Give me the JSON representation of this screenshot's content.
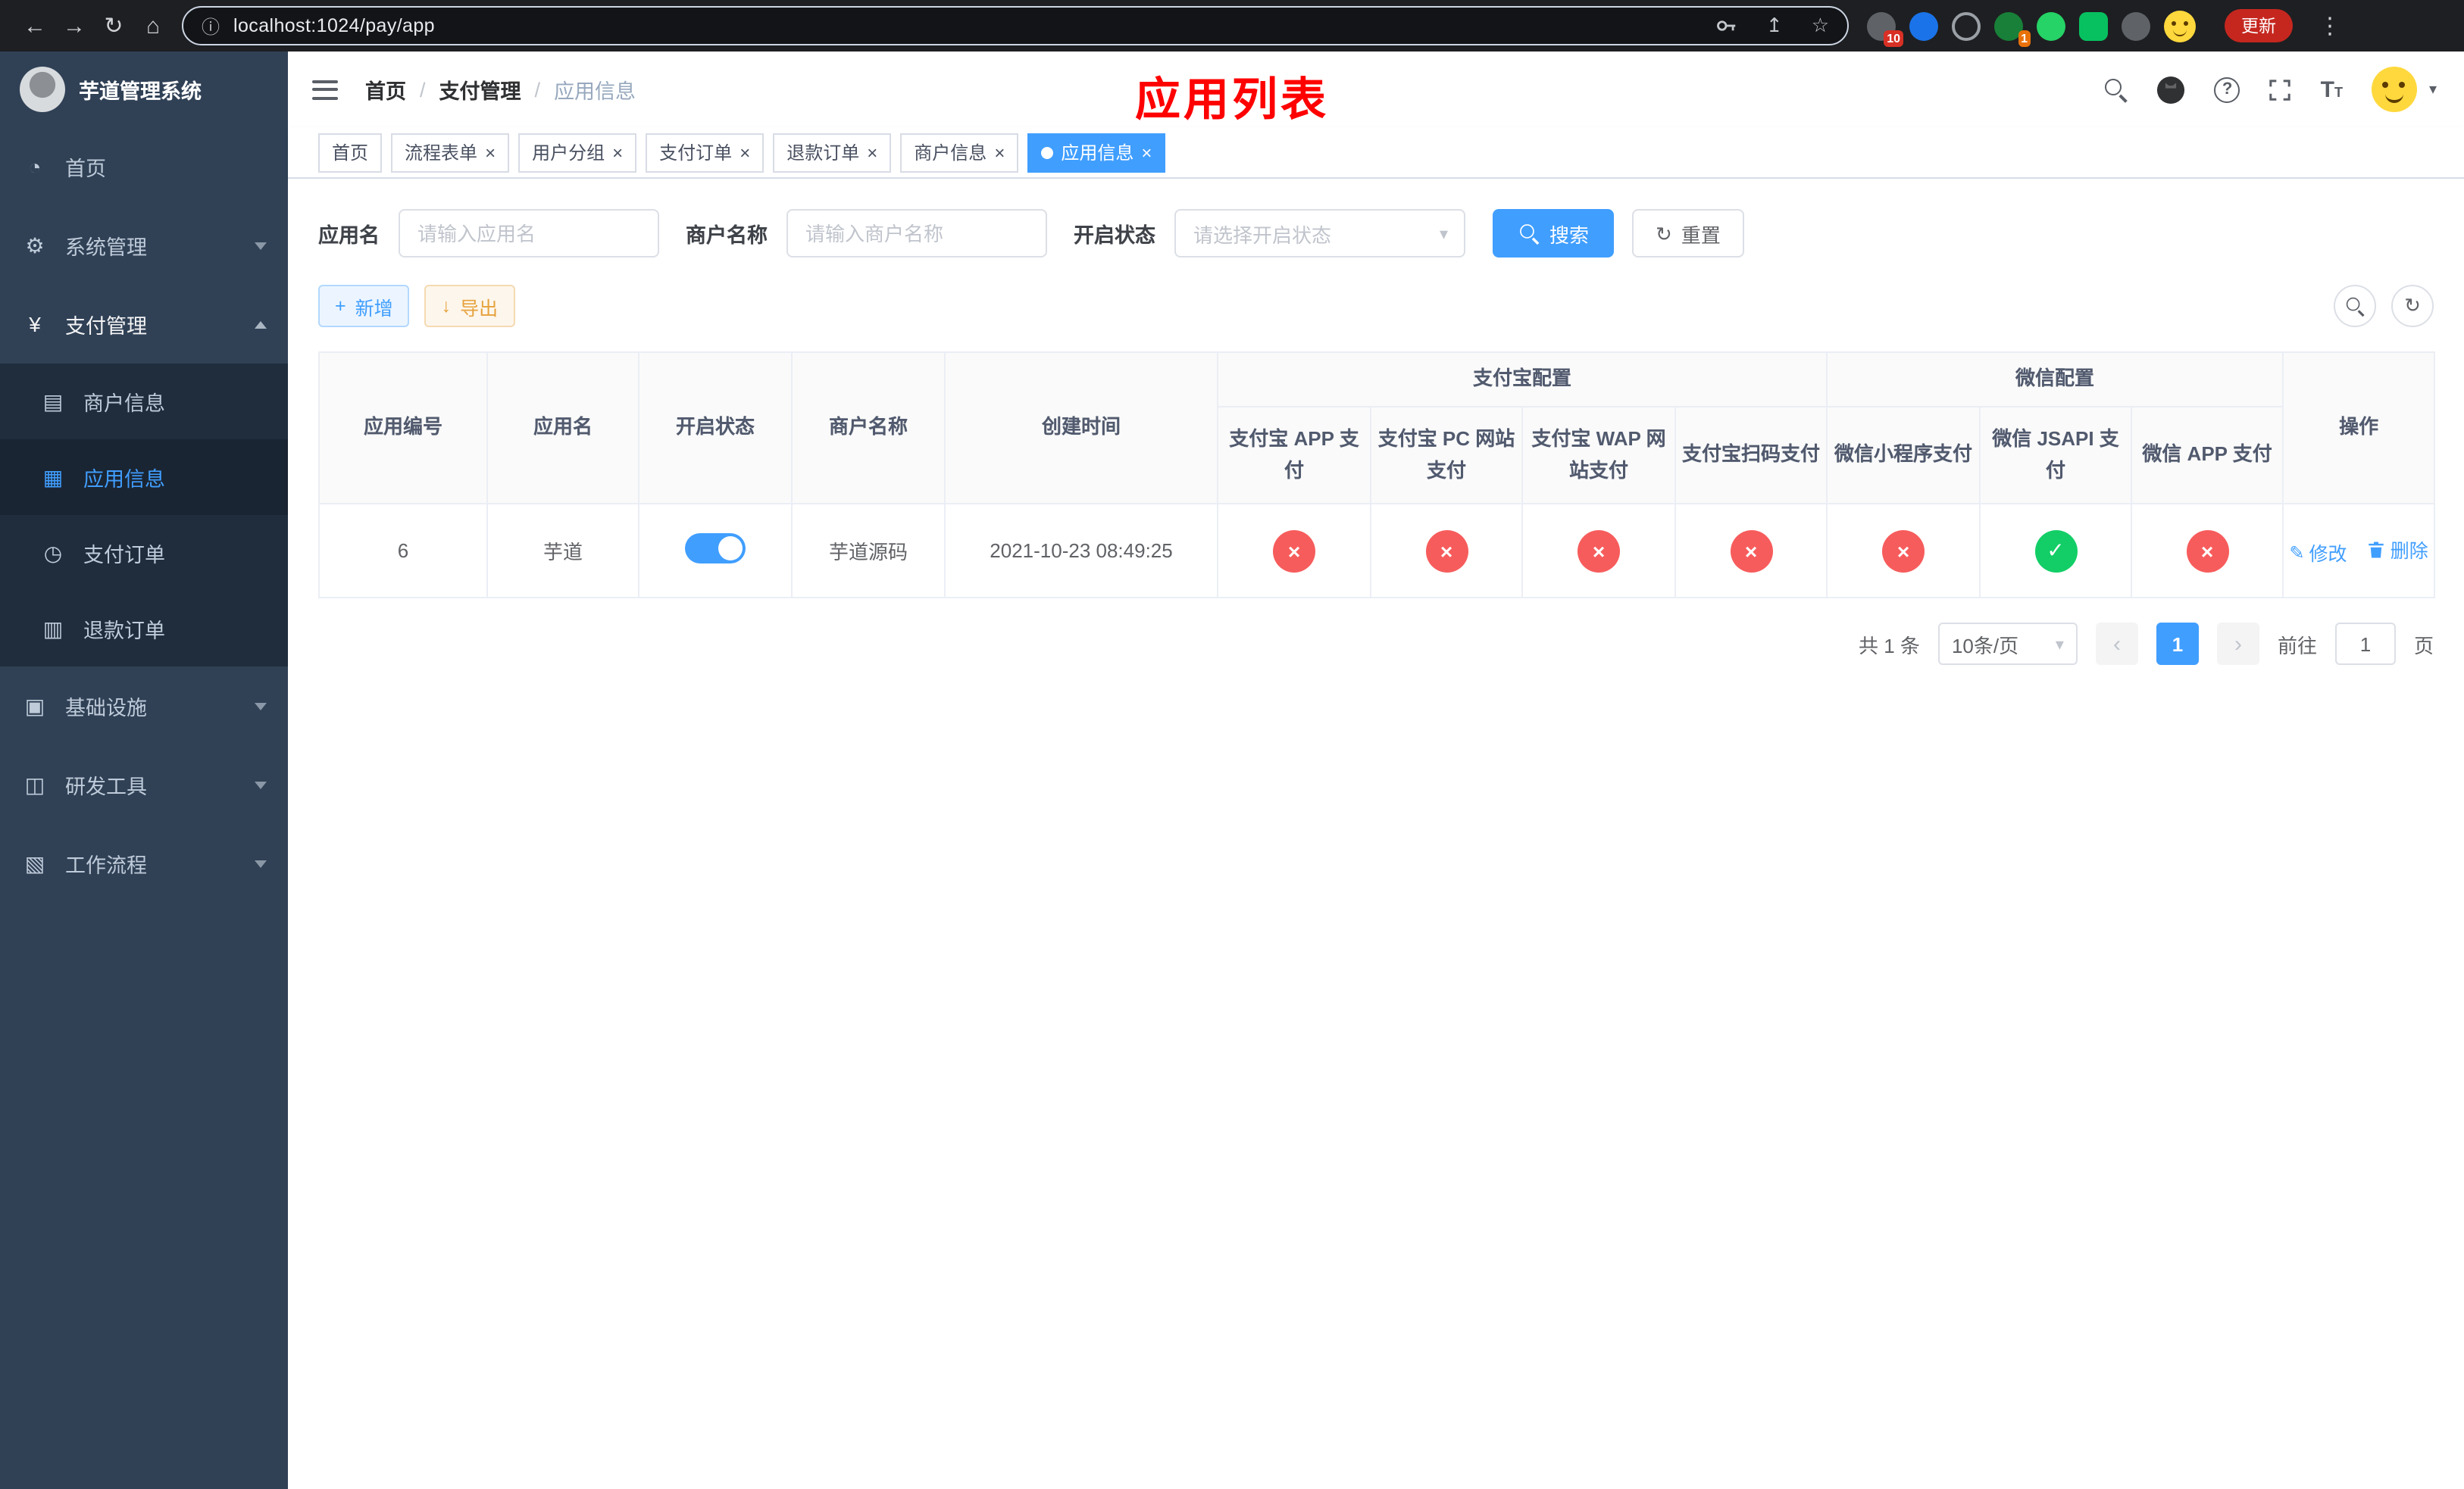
{
  "colors": {
    "primary": "#409EFF",
    "success": "#13ce66",
    "danger": "#f75c5c",
    "warning": "#e6a23c",
    "sidebar_bg": "#304156",
    "submenu_bg": "#1f2d3d",
    "tag_active": "#409EFF",
    "annotation_red": "#ff0000",
    "update_chip": "#c5271f"
  },
  "icons": {
    "back": "←",
    "forward": "→",
    "reload": "↻",
    "home": "⌂",
    "info": "ⓘ",
    "share": "↥",
    "star": "☆",
    "kebab": "⋮",
    "dashboard": "◔",
    "gear": "⚙",
    "yen": "¥",
    "card": "▤",
    "grid": "▦",
    "order": "◷",
    "refund": "▥",
    "infra": "▣",
    "tools": "◫",
    "workflow": "▧",
    "slash": "/",
    "help": "?",
    "font_large": "T",
    "font_small": "T",
    "caret_small": "▾",
    "caret": "▾",
    "close": "×",
    "check": "✓",
    "cross": "×",
    "plus": "+",
    "download": "↓",
    "refresh": "↻",
    "edit": "✎",
    "prev": "‹",
    "next": "›"
  },
  "browser": {
    "url": "localhost:1024/pay/app",
    "update_label": "更新",
    "ext_badges": {
      "first": "10",
      "second": "1"
    }
  },
  "sidebar": {
    "title": "芋道管理系统",
    "items": [
      {
        "label": "首页"
      },
      {
        "label": "系统管理"
      },
      {
        "label": "支付管理"
      },
      {
        "label": "基础设施"
      },
      {
        "label": "研发工具"
      },
      {
        "label": "工作流程"
      }
    ],
    "submenu": [
      {
        "label": "商户信息"
      },
      {
        "label": "应用信息"
      },
      {
        "label": "支付订单"
      },
      {
        "label": "退款订单"
      }
    ]
  },
  "navbar": {
    "breadcrumb": [
      "首页",
      "支付管理",
      "应用信息"
    ],
    "annotation": "应用列表"
  },
  "tabs": [
    {
      "label": "首页"
    },
    {
      "label": "流程表单"
    },
    {
      "label": "用户分组"
    },
    {
      "label": "支付订单"
    },
    {
      "label": "退款订单"
    },
    {
      "label": "商户信息"
    },
    {
      "label": "应用信息"
    }
  ],
  "search": {
    "app_name_label": "应用名",
    "app_name_placeholder": "请输入应用名",
    "merchant_label": "商户名称",
    "merchant_placeholder": "请输入商户名称",
    "status_label": "开启状态",
    "status_placeholder": "请选择开启状态",
    "search_button": "搜索",
    "reset_button": "重置"
  },
  "toolbar": {
    "add_button": "新增",
    "export_button": "导出"
  },
  "table": {
    "group_headers": {
      "alipay": "支付宝配置",
      "wechat": "微信配置"
    },
    "columns": [
      "应用编号",
      "应用名",
      "开启状态",
      "商户名称",
      "创建时间",
      "支付宝 APP 支付",
      "支付宝 PC 网站支付",
      "支付宝 WAP 网站支付",
      "支付宝扫码支付",
      "微信小程序支付",
      "微信 JSAPI 支付",
      "微信 APP 支付",
      "操作"
    ],
    "rows": [
      {
        "id": "6",
        "name": "芋道",
        "enabled": true,
        "merchant": "芋道源码",
        "created": "2021-10-23 08:49:25",
        "configs": {
          "alipay_app": false,
          "alipay_pc": false,
          "alipay_wap": false,
          "alipay_qr": false,
          "wx_lite": false,
          "wx_jsapi": true,
          "wx_app": false
        },
        "edit_label": "修改",
        "delete_label": "删除"
      }
    ]
  },
  "pagination": {
    "total": "共 1 条",
    "page_size": "10条/页",
    "current_page": "1",
    "goto_label": "前往",
    "goto_value": "1",
    "page_unit": "页"
  }
}
